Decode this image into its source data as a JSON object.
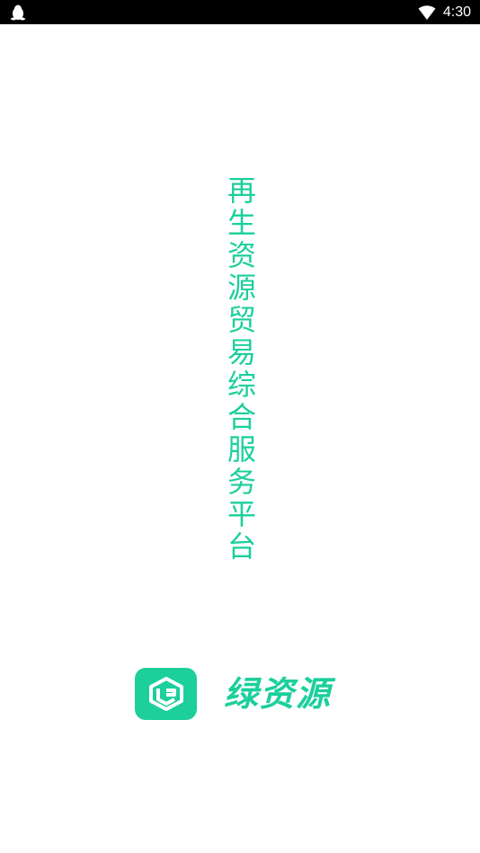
{
  "status_bar": {
    "time": "4:30",
    "left_icon": "qq-penguin-icon",
    "right_icon": "wifi-icon"
  },
  "splash": {
    "slogan": "再生资源贸易综合服务平台",
    "brand_name": "绿资源",
    "logo_icon": "cube-logo-icon",
    "accent_color": "#1ccf9b"
  }
}
